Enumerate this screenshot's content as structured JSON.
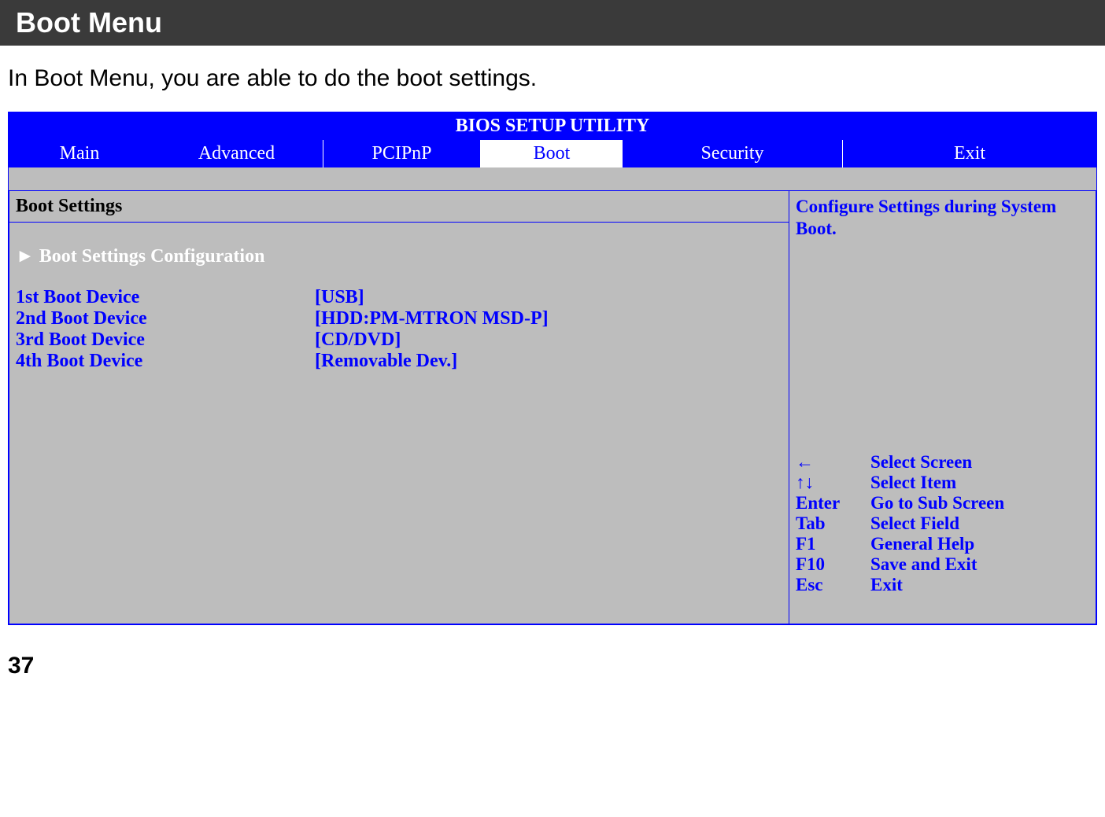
{
  "page": {
    "title": "Boot Menu",
    "description": "In Boot Menu, you are able to do the boot settings.",
    "pageNumber": "37"
  },
  "bios": {
    "title": "BIOS SETUP UTILITY",
    "tabs": {
      "main": "Main",
      "advanced": "Advanced",
      "pcipnp": "PCIPnP",
      "boot": "Boot",
      "security": "Security",
      "exit": "Exit"
    },
    "sectionHeader": "Boot Settings",
    "configLink": "► Boot Settings Configuration",
    "bootDevices": [
      {
        "label": "1st Boot Device",
        "value": "[USB]"
      },
      {
        "label": "2nd Boot Device",
        "value": "[HDD:PM-MTRON MSD-P]"
      },
      {
        "label": "3rd Boot Device",
        "value": "[CD/DVD]"
      },
      {
        "label": "4th Boot Device",
        "value": "[Removable Dev.]"
      }
    ],
    "helpText": "Configure Settings during System Boot.",
    "keyHints": [
      {
        "key": "←",
        "action": "Select Screen"
      },
      {
        "key": "↑↓",
        "action": "Select Item"
      },
      {
        "key": " Enter",
        "action": "Go to Sub Screen"
      },
      {
        "key": "Tab",
        "action": "Select Field"
      },
      {
        "key": "F1",
        "action": "General Help"
      },
      {
        "key": "F10",
        "action": "Save and Exit"
      },
      {
        "key": "Esc",
        "action": "Exit"
      }
    ]
  }
}
